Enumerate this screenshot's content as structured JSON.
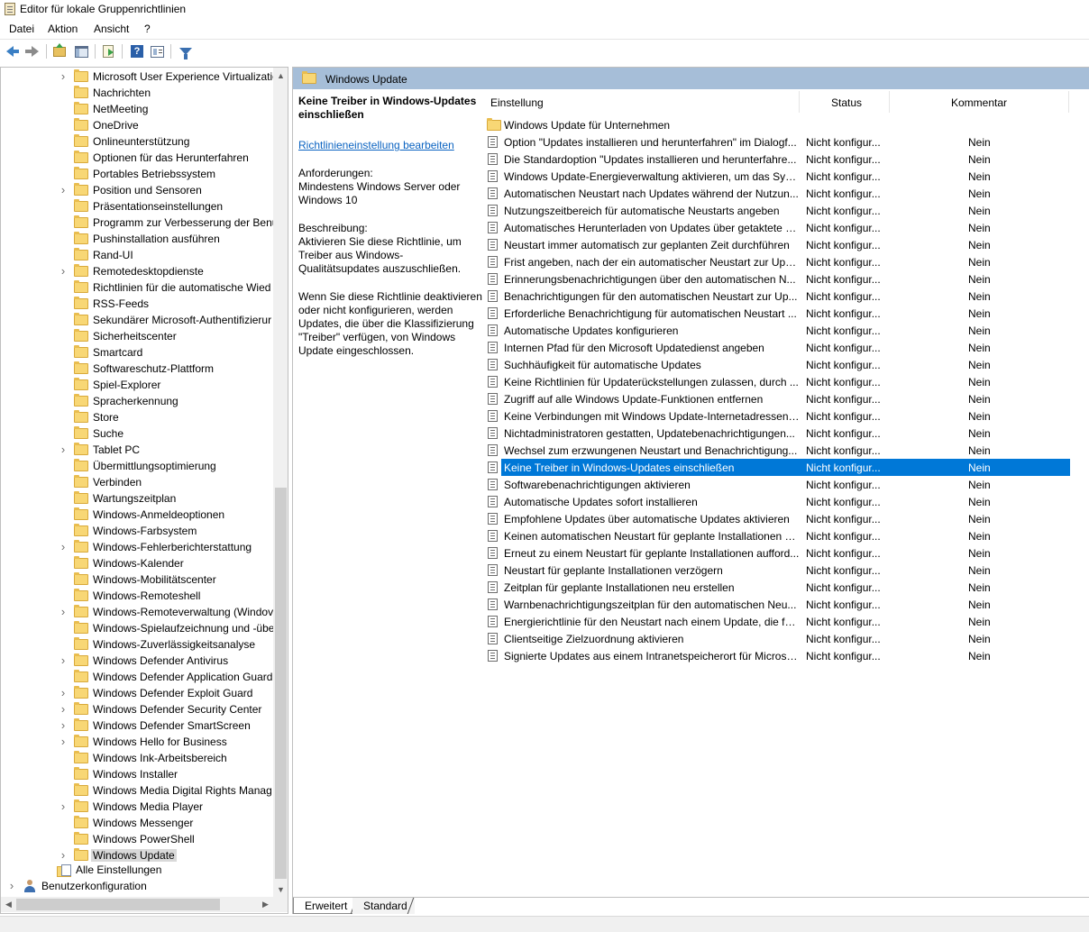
{
  "window": {
    "title": "Editor für lokale Gruppenrichtlinien"
  },
  "menu": [
    "Datei",
    "Aktion",
    "Ansicht",
    "?"
  ],
  "toolbar": [
    "back-arrow-icon",
    "forward-arrow-icon",
    "up-folder-icon",
    "show-hide-console-tree-icon",
    "export-list-icon",
    "help-icon",
    "properties-icon",
    "filter-icon"
  ],
  "tree": [
    {
      "label": "Microsoft User Experience Virtualizatio",
      "expandable": true
    },
    {
      "label": "Nachrichten",
      "expandable": false
    },
    {
      "label": "NetMeeting",
      "expandable": false
    },
    {
      "label": "OneDrive",
      "expandable": false
    },
    {
      "label": "Onlineunterstützung",
      "expandable": false
    },
    {
      "label": "Optionen für das Herunterfahren",
      "expandable": false
    },
    {
      "label": "Portables Betriebssystem",
      "expandable": false
    },
    {
      "label": "Position und Sensoren",
      "expandable": true
    },
    {
      "label": "Präsentationseinstellungen",
      "expandable": false
    },
    {
      "label": "Programm zur Verbesserung der Benu",
      "expandable": false
    },
    {
      "label": "Pushinstallation ausführen",
      "expandable": false
    },
    {
      "label": "Rand-UI",
      "expandable": false
    },
    {
      "label": "Remotedesktopdienste",
      "expandable": true
    },
    {
      "label": "Richtlinien für die automatische Wied",
      "expandable": false
    },
    {
      "label": "RSS-Feeds",
      "expandable": false
    },
    {
      "label": "Sekundärer Microsoft-Authentifizierur",
      "expandable": false
    },
    {
      "label": "Sicherheitscenter",
      "expandable": false
    },
    {
      "label": "Smartcard",
      "expandable": false
    },
    {
      "label": "Softwareschutz-Plattform",
      "expandable": false
    },
    {
      "label": "Spiel-Explorer",
      "expandable": false
    },
    {
      "label": "Spracherkennung",
      "expandable": false
    },
    {
      "label": "Store",
      "expandable": false
    },
    {
      "label": "Suche",
      "expandable": false
    },
    {
      "label": "Tablet PC",
      "expandable": true
    },
    {
      "label": "Übermittlungsoptimierung",
      "expandable": false
    },
    {
      "label": "Verbinden",
      "expandable": false
    },
    {
      "label": "Wartungszeitplan",
      "expandable": false
    },
    {
      "label": "Windows-Anmeldeoptionen",
      "expandable": false
    },
    {
      "label": "Windows-Farbsystem",
      "expandable": false
    },
    {
      "label": "Windows-Fehlerberichterstattung",
      "expandable": true
    },
    {
      "label": "Windows-Kalender",
      "expandable": false
    },
    {
      "label": "Windows-Mobilitätscenter",
      "expandable": false
    },
    {
      "label": "Windows-Remoteshell",
      "expandable": false
    },
    {
      "label": "Windows-Remoteverwaltung (Windov",
      "expandable": true
    },
    {
      "label": "Windows-Spielaufzeichnung und -übe",
      "expandable": false
    },
    {
      "label": "Windows-Zuverlässigkeitsanalyse",
      "expandable": false
    },
    {
      "label": "Windows Defender Antivirus",
      "expandable": true
    },
    {
      "label": "Windows Defender Application Guard",
      "expandable": false
    },
    {
      "label": "Windows Defender Exploit Guard",
      "expandable": true
    },
    {
      "label": "Windows Defender Security Center",
      "expandable": true
    },
    {
      "label": "Windows Defender SmartScreen",
      "expandable": true
    },
    {
      "label": "Windows Hello for Business",
      "expandable": true
    },
    {
      "label": "Windows Ink-Arbeitsbereich",
      "expandable": false
    },
    {
      "label": "Windows Installer",
      "expandable": false
    },
    {
      "label": "Windows Media Digital Rights Manag",
      "expandable": false
    },
    {
      "label": "Windows Media Player",
      "expandable": true
    },
    {
      "label": "Windows Messenger",
      "expandable": false
    },
    {
      "label": "Windows PowerShell",
      "expandable": false
    },
    {
      "label": "Windows Update",
      "expandable": true,
      "selected": true
    }
  ],
  "tree_extra": {
    "all_settings": "Alle Einstellungen",
    "user_config": "Benutzerkonfiguration"
  },
  "right": {
    "header_title": "Windows Update",
    "desc_title": "Keine Treiber in Windows-Updates einschließen",
    "edit_link": "Richtlinieneinstellung bearbeiten",
    "requirements": "Anforderungen:\nMindestens Windows Server oder Windows 10",
    "description": "Beschreibung:\nAktivieren Sie diese Richtlinie, um Treiber aus Windows-Qualitätsupdates auszuschließen.",
    "description2": "Wenn Sie diese Richtlinie deaktivieren oder nicht konfigurieren, werden Updates, die über die Klassifizierung \"Treiber\" verfügen, von Windows Update eingeschlossen."
  },
  "columns": {
    "setting": "Einstellung",
    "status": "Status",
    "comment": "Kommentar"
  },
  "rows": [
    {
      "type": "folder",
      "name": "Windows Update für Unternehmen",
      "status": "",
      "comment": ""
    },
    {
      "type": "policy",
      "name": "Option \"Updates installieren und herunterfahren\" im Dialogf...",
      "status": "Nicht konfigur...",
      "comment": "Nein"
    },
    {
      "type": "policy",
      "name": "Die Standardoption \"Updates installieren und herunterfahre...",
      "status": "Nicht konfigur...",
      "comment": "Nein"
    },
    {
      "type": "policy",
      "name": "Windows Update-Energieverwaltung aktivieren, um das Syst...",
      "status": "Nicht konfigur...",
      "comment": "Nein"
    },
    {
      "type": "policy",
      "name": "Automatischen Neustart nach Updates während der Nutzun...",
      "status": "Nicht konfigur...",
      "comment": "Nein"
    },
    {
      "type": "policy",
      "name": "Nutzungszeitbereich für automatische Neustarts angeben",
      "status": "Nicht konfigur...",
      "comment": "Nein"
    },
    {
      "type": "policy",
      "name": "Automatisches Herunterladen von Updates über getaktete V...",
      "status": "Nicht konfigur...",
      "comment": "Nein"
    },
    {
      "type": "policy",
      "name": "Neustart immer automatisch zur geplanten Zeit durchführen",
      "status": "Nicht konfigur...",
      "comment": "Nein"
    },
    {
      "type": "policy",
      "name": "Frist angeben, nach der ein automatischer Neustart zur Upd...",
      "status": "Nicht konfigur...",
      "comment": "Nein"
    },
    {
      "type": "policy",
      "name": "Erinnerungsbenachrichtigungen über den automatischen N...",
      "status": "Nicht konfigur...",
      "comment": "Nein"
    },
    {
      "type": "policy",
      "name": "Benachrichtigungen für den automatischen Neustart zur Up...",
      "status": "Nicht konfigur...",
      "comment": "Nein"
    },
    {
      "type": "policy",
      "name": "Erforderliche Benachrichtigung für automatischen Neustart ...",
      "status": "Nicht konfigur...",
      "comment": "Nein"
    },
    {
      "type": "policy",
      "name": "Automatische Updates konfigurieren",
      "status": "Nicht konfigur...",
      "comment": "Nein"
    },
    {
      "type": "policy",
      "name": "Internen Pfad für den Microsoft Updatedienst angeben",
      "status": "Nicht konfigur...",
      "comment": "Nein"
    },
    {
      "type": "policy",
      "name": "Suchhäufigkeit für automatische Updates",
      "status": "Nicht konfigur...",
      "comment": "Nein"
    },
    {
      "type": "policy",
      "name": "Keine Richtlinien für Updaterückstellungen zulassen, durch ...",
      "status": "Nicht konfigur...",
      "comment": "Nein"
    },
    {
      "type": "policy",
      "name": "Zugriff auf alle Windows Update-Funktionen entfernen",
      "status": "Nicht konfigur...",
      "comment": "Nein"
    },
    {
      "type": "policy",
      "name": "Keine Verbindungen mit Windows Update-Internetadressen ...",
      "status": "Nicht konfigur...",
      "comment": "Nein"
    },
    {
      "type": "policy",
      "name": "Nichtadministratoren gestatten, Updatebenachrichtigungen...",
      "status": "Nicht konfigur...",
      "comment": "Nein"
    },
    {
      "type": "policy",
      "name": "Wechsel zum erzwungenen Neustart und Benachrichtigung...",
      "status": "Nicht konfigur...",
      "comment": "Nein"
    },
    {
      "type": "policy",
      "name": "Keine Treiber in Windows-Updates einschließen",
      "status": "Nicht konfigur...",
      "comment": "Nein",
      "selected": true
    },
    {
      "type": "policy",
      "name": "Softwarebenachrichtigungen aktivieren",
      "status": "Nicht konfigur...",
      "comment": "Nein"
    },
    {
      "type": "policy",
      "name": "Automatische Updates sofort installieren",
      "status": "Nicht konfigur...",
      "comment": "Nein"
    },
    {
      "type": "policy",
      "name": "Empfohlene Updates über automatische Updates aktivieren",
      "status": "Nicht konfigur...",
      "comment": "Nein"
    },
    {
      "type": "policy",
      "name": "Keinen automatischen Neustart für geplante Installationen a...",
      "status": "Nicht konfigur...",
      "comment": "Nein"
    },
    {
      "type": "policy",
      "name": "Erneut zu einem Neustart für geplante Installationen aufford...",
      "status": "Nicht konfigur...",
      "comment": "Nein"
    },
    {
      "type": "policy",
      "name": "Neustart für geplante Installationen verzögern",
      "status": "Nicht konfigur...",
      "comment": "Nein"
    },
    {
      "type": "policy",
      "name": "Zeitplan für geplante Installationen neu erstellen",
      "status": "Nicht konfigur...",
      "comment": "Nein"
    },
    {
      "type": "policy",
      "name": "Warnbenachrichtigungszeitplan für den automatischen Neu...",
      "status": "Nicht konfigur...",
      "comment": "Nein"
    },
    {
      "type": "policy",
      "name": "Energierichtlinie für den Neustart nach einem Update, die fü...",
      "status": "Nicht konfigur...",
      "comment": "Nein"
    },
    {
      "type": "policy",
      "name": "Clientseitige Zielzuordnung aktivieren",
      "status": "Nicht konfigur...",
      "comment": "Nein"
    },
    {
      "type": "policy",
      "name": "Signierte Updates aus einem Intranetspeicherort für Microso...",
      "status": "Nicht konfigur...",
      "comment": "Nein"
    }
  ],
  "tabs": [
    "Erweitert",
    "Standard"
  ],
  "colors": {
    "selection": "#0078d7",
    "header_bar": "#a6bed8",
    "link": "#0b63c1"
  }
}
